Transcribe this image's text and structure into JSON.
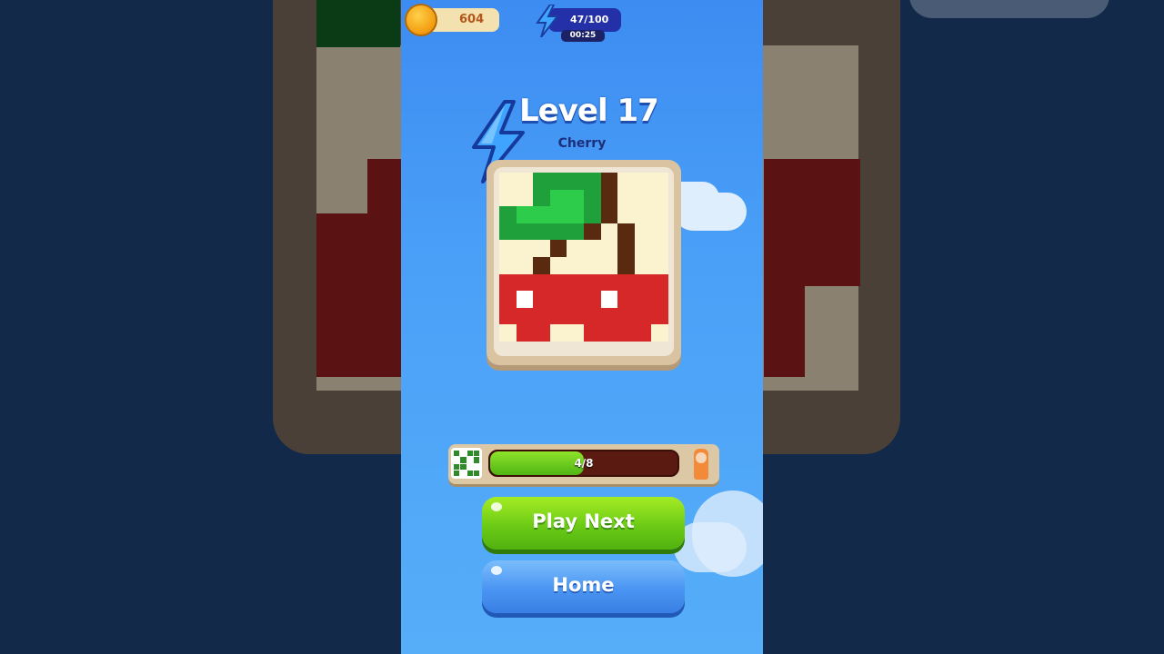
{
  "hud": {
    "coins": "604",
    "energy": "47/100",
    "energy_timer": "00:25"
  },
  "level": {
    "title": "Level 17",
    "subtitle": "Cherry"
  },
  "progress": {
    "label": "4/8",
    "fraction": 0.5
  },
  "buttons": {
    "play_next": "Play Next",
    "home": "Home"
  },
  "colors": {
    "bg_blue": "#4aa0f7",
    "play_green": "#6ccb16",
    "home_blue": "#4a95f3",
    "cream": "#fbf2d0",
    "cherry_red": "#d62828",
    "stem_brown": "#5a2a10",
    "leaf_green": "#1fa03a"
  },
  "puzzle_pixels": [
    "CCGGGGBCCC",
    "CCGLLGBCCC",
    "GLLLLGBCCC",
    "GGGGGBCBCC",
    "CCCBCCCBCC",
    "CCBCCCCBCC",
    "RRRRRRRRRR",
    "RWRRRRWRRR",
    "RRRRRRRRRR",
    "CRRCCRRRRC"
  ],
  "pixel_palette": {
    "C": "#fbf2d0",
    "G": "#1fa03a",
    "L": "#2dcc4a",
    "B": "#5a2a10",
    "R": "#d62828",
    "W": "#ffffff"
  }
}
